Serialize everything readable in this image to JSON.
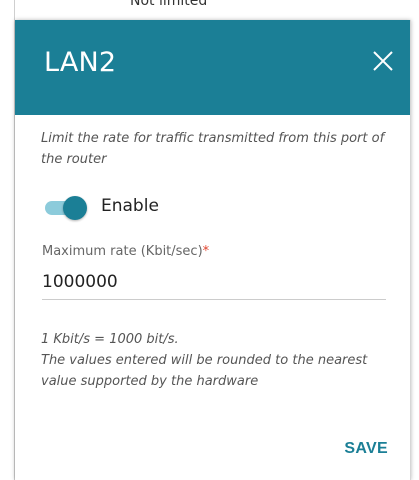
{
  "background": {
    "partial_text": "Not limited"
  },
  "dialog": {
    "title": "LAN2",
    "close_icon": "close-icon",
    "description": "Limit the rate for traffic transmitted from this port of the router",
    "toggle": {
      "label": "Enable",
      "checked": true
    },
    "field": {
      "label": "Maximum rate (Kbit/sec)",
      "required_mark": "*",
      "value": "1000000"
    },
    "hint_line1": "1 Kbit/s = 1000 bit/s.",
    "hint_line2": "The values entered will be rounded to the nearest value supported by the hardware",
    "save_label": "SAVE"
  },
  "colors": {
    "header": "#1b7f96",
    "accent": "#1b7f96",
    "toggle_track": "#8ccbdb",
    "required": "#e0432d"
  }
}
